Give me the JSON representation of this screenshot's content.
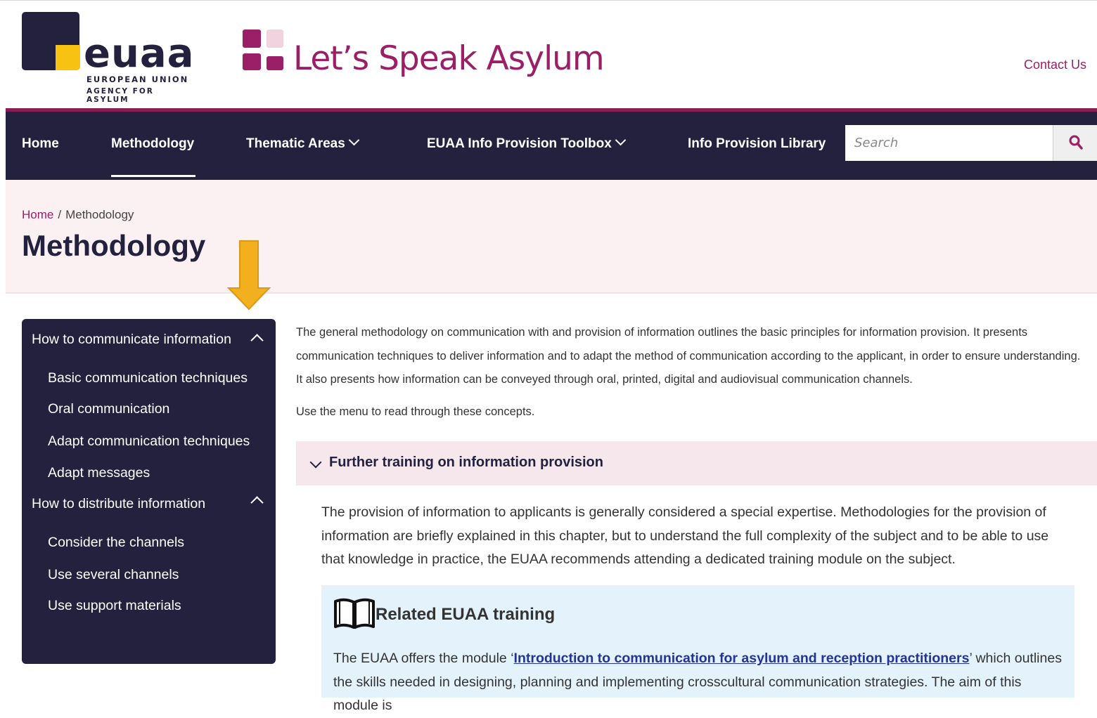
{
  "logo": {
    "word": "euaa",
    "line1": "EUROPEAN UNION",
    "line2": "AGENCY FOR ASYLUM"
  },
  "site_title": "Let’s Speak Asylum",
  "header": {
    "contact": "Contact Us"
  },
  "nav": {
    "home": "Home",
    "methodology": "Methodology",
    "thematic": "Thematic Areas",
    "toolbox": "EUAA Info Provision Toolbox",
    "library": "Info Provision Library",
    "search_placeholder": "Search",
    "active": "Methodology"
  },
  "breadcrumb": {
    "home": "Home",
    "separator": "/",
    "current": "Methodology"
  },
  "page_title": "Methodology",
  "sidebar": {
    "section1": "How to communicate information",
    "items1": [
      "Basic communication techniques",
      "Oral communication",
      "Adapt communication techniques",
      "Adapt messages"
    ],
    "section2": "How to distribute information",
    "items2": [
      "Consider the channels",
      "Use several channels",
      "Use support materials"
    ]
  },
  "main": {
    "intro": "The general methodology on communication with and provision of information outlines the basic principles for information provision. It presents communication techniques to deliver information and to adapt the method of communication according to the applicant, in order to ensure understanding. It also presents how information can be conveyed through oral, printed, digital and audiovisual communication channels.",
    "hint": "Use the menu to read through these concepts.",
    "accordion_title": "Further training on information provision",
    "accordion_body": "The provision of information to applicants is generally considered a special expertise. Methodologies for the provision of information are briefly explained in this chapter, but to understand the full complexity of the subject and to be able to use that knowledge in practice, the EUAA recommends attending a dedicated training module on the subject.",
    "related_title": "Related EUAA training",
    "related_pre": "The EUAA offers the module ‘",
    "related_link": "Introduction to communication for asylum and reception practitioners",
    "related_post": "’ which outlines the skills needed in designing, planning and implementing crosscultural communication strategies. The aim of this module is"
  },
  "colors": {
    "navy": "#24213f",
    "magenta": "#9b1f66",
    "yellow": "#f8c212",
    "band": "#fbf1f3",
    "accordion": "#f6e7ec",
    "related_bg": "#e3f2fb",
    "arrow": "#f2b01e"
  },
  "icons": {
    "search": "search-icon",
    "book": "book-icon",
    "arrow": "down-arrow-annotation"
  }
}
